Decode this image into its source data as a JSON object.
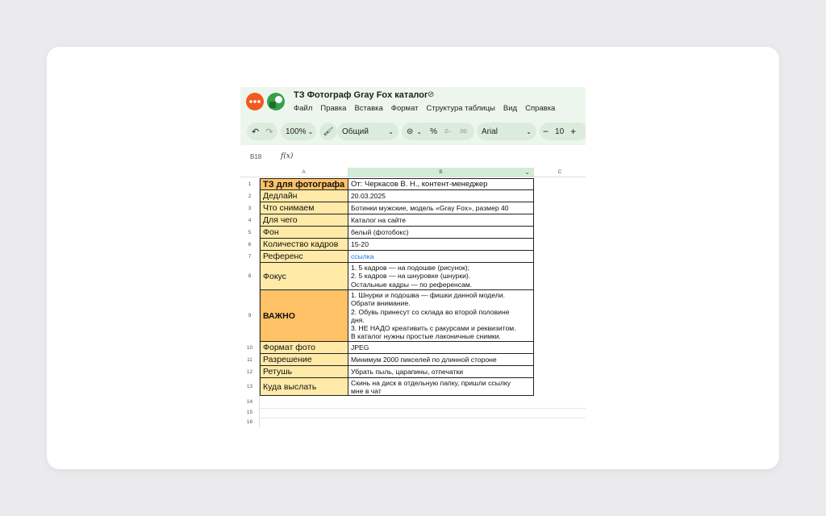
{
  "app": {
    "title": "ТЗ Фотограф Gray Fox каталог",
    "menu": [
      "Файл",
      "Правка",
      "Вставка",
      "Формат",
      "Структура таблицы",
      "Вид",
      "Справка"
    ]
  },
  "toolbar": {
    "undo_icon": "undo-icon",
    "redo_icon": "redo-icon",
    "zoom": "100%",
    "paint_icon": "paint-format-icon",
    "number_format": "Общий",
    "currency_icon": "currency-icon",
    "percent": "%",
    "font": "Arial",
    "font_size": "10",
    "minus": "−",
    "plus": "+"
  },
  "formula_bar": {
    "cell_ref": "B18",
    "fx": "f(x)",
    "value": ""
  },
  "columns": [
    "A",
    "B",
    "C"
  ],
  "rows": [
    {
      "n": "1",
      "a": "ТЗ для фотографа",
      "b": "От: Черкасов В. Н., контент-менеджер"
    },
    {
      "n": "2",
      "a": "Дедлайн",
      "b": "20.03.2025"
    },
    {
      "n": "3",
      "a": "Что снимаем",
      "b": "Ботинки мужские, модель «Gray Fox», размер 40"
    },
    {
      "n": "4",
      "a": "Для чего",
      "b": "Каталог на сайте"
    },
    {
      "n": "5",
      "a": "Фон",
      "b": "белый (фотобокс)"
    },
    {
      "n": "6",
      "a": "Количество кадров",
      "b": "15-20"
    },
    {
      "n": "7",
      "a": "Референс",
      "b": "ссылка"
    },
    {
      "n": "8",
      "a": "Фокус",
      "b": [
        "1. 5 кадров — на подошве (рисунок);",
        "2. 5 кадров — на шнуровке (шнурки).",
        "Остальные кадры — по референсам."
      ]
    },
    {
      "n": "9",
      "a": "ВАЖНО",
      "b": [
        "1. Шнурки и подошва — фишки данной модели.",
        "Обрати внимание.",
        "2. Обувь принесут со склада во второй половине",
        "дня.",
        "3. НЕ НАДО креативить с ракурсами и реквизитом.",
        "В каталог нужны простые лаконичные снимки."
      ]
    },
    {
      "n": "10",
      "a": "Формат фото",
      "b": "JPEG"
    },
    {
      "n": "11",
      "a": "Разрешение",
      "b": "Минимум 2000 пикселей по длинной стороне"
    },
    {
      "n": "12",
      "a": "Ретушь",
      "b": "Убрать пыль, царапины, отпечатки"
    },
    {
      "n": "13",
      "a": "Куда выслать",
      "b": [
        "Скинь на диск в отдельную папку, пришли ссылку",
        "мне в чат"
      ]
    },
    {
      "n": "14",
      "a": "",
      "b": ""
    },
    {
      "n": "15",
      "a": "",
      "b": ""
    },
    {
      "n": "16",
      "a": "",
      "b": ""
    }
  ],
  "colors": {
    "label_fill": "#ffeaa8",
    "important_fill": "#ffc266",
    "header_fill": "#ffc266",
    "link": "#1a73e8",
    "chrome": "#edf6ed"
  }
}
